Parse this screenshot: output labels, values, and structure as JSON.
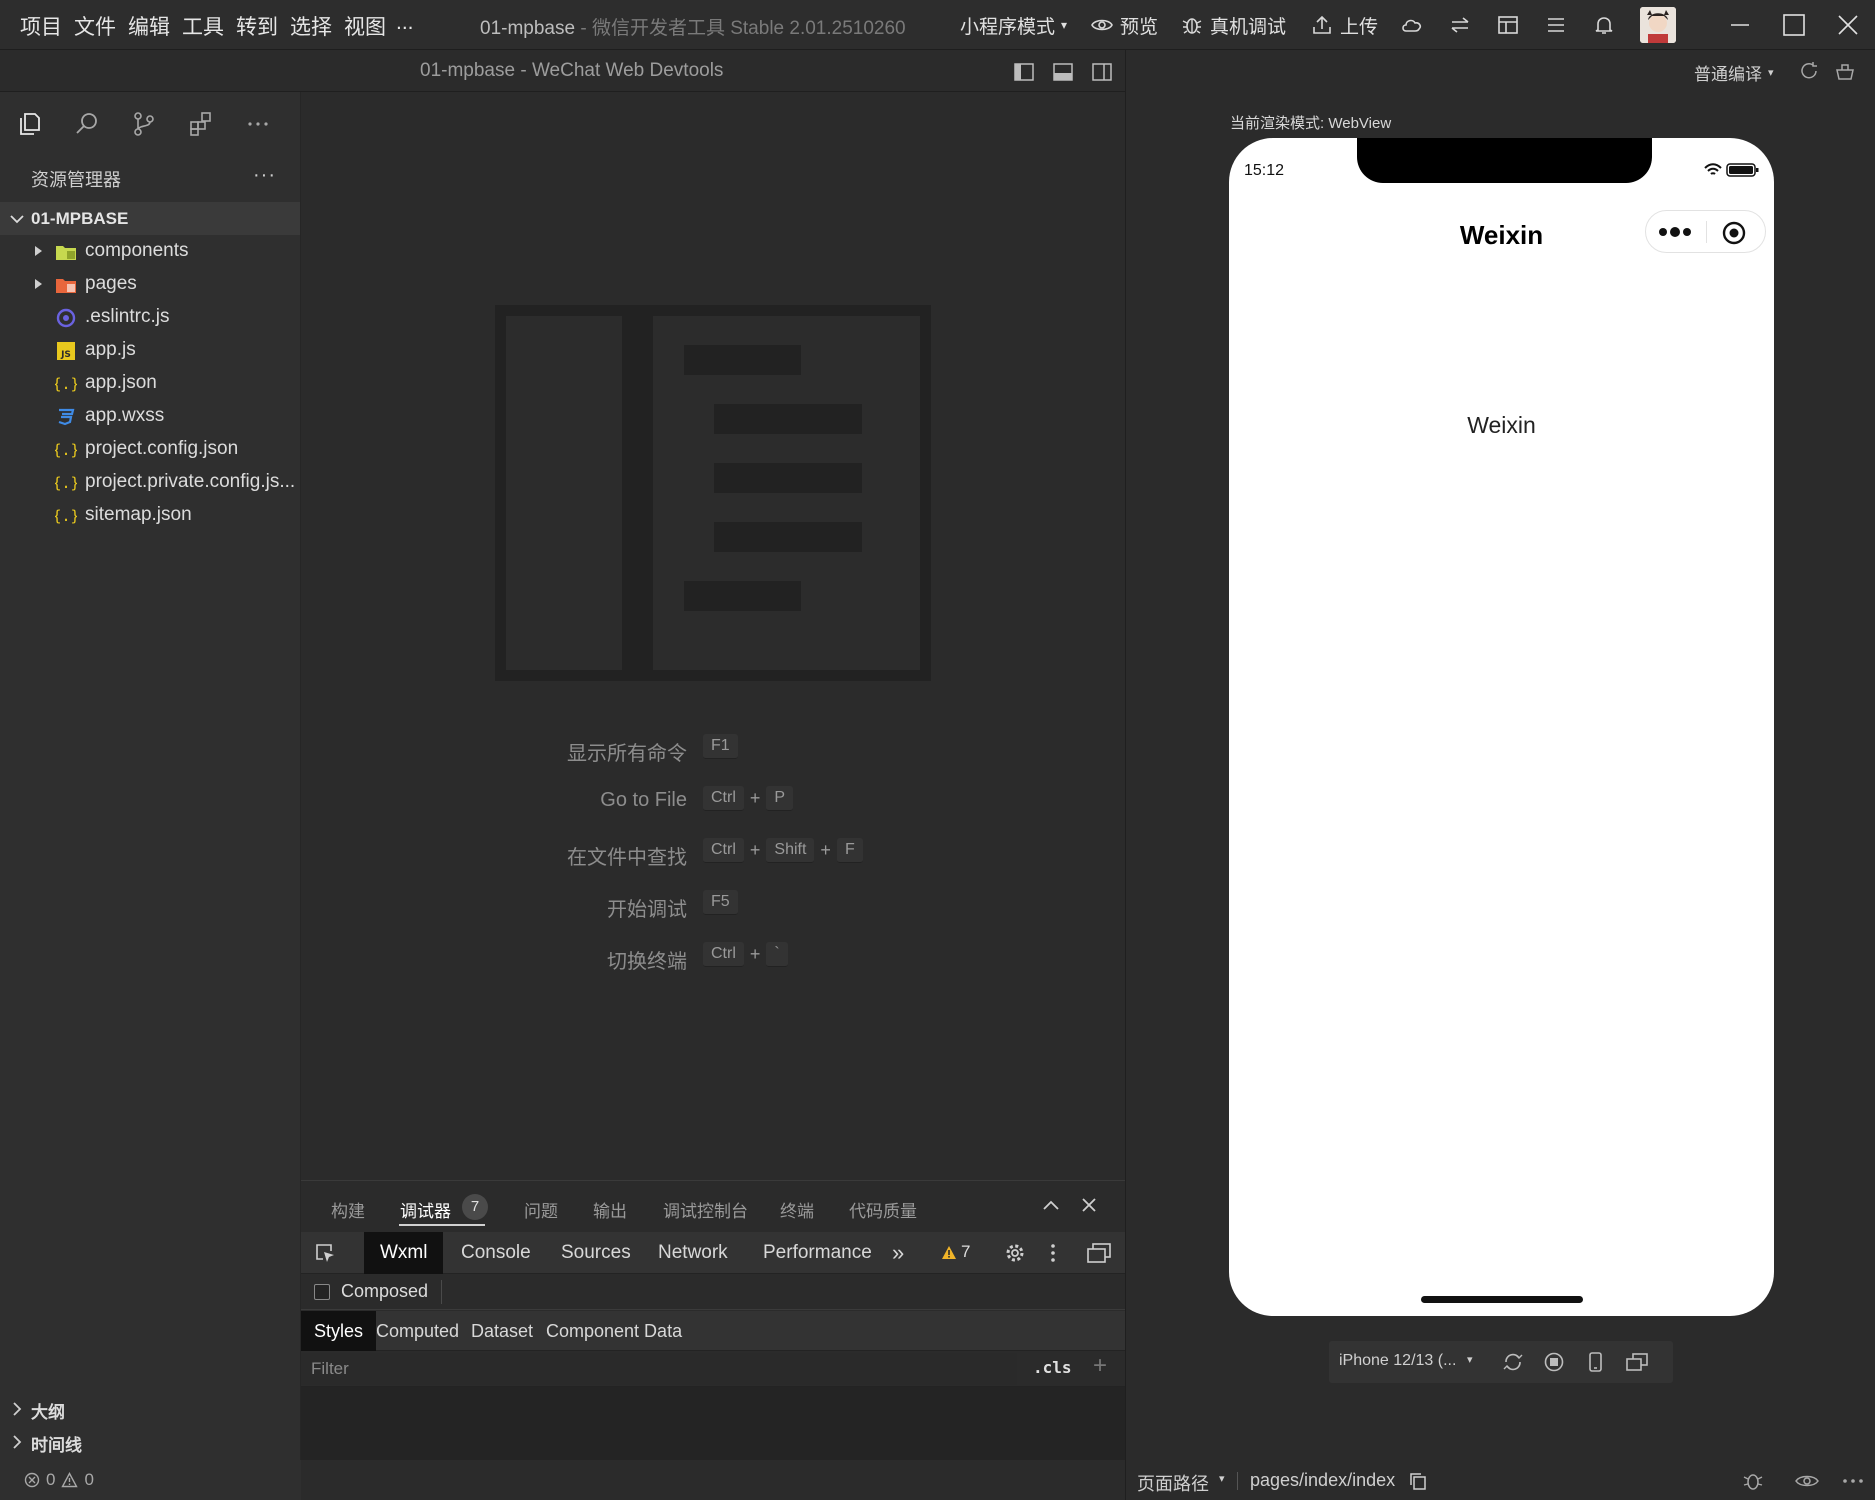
{
  "titlebar": {
    "menu": [
      "项目",
      "文件",
      "编辑",
      "工具",
      "转到",
      "选择",
      "视图",
      "..."
    ],
    "project": "01-mpbase",
    "subtitle": "- 微信开发者工具 Stable 2.01.2510260",
    "mode": "小程序模式",
    "preview": "预览",
    "device_debug": "真机调试",
    "upload": "上传",
    "icons": [
      "eye-icon",
      "bug-icon",
      "upload-icon",
      "cloud-icon",
      "swap-icon",
      "layout-icon",
      "menu-icon",
      "bell-icon"
    ]
  },
  "editor_header": {
    "title": "01-mpbase - WeChat Web Devtools",
    "compile_mode": "普通编译"
  },
  "sidebar": {
    "explorer_title": "资源管理器",
    "more": "···",
    "root": "01-MPBASE",
    "files": [
      {
        "name": "components",
        "type": "folder",
        "icon": "folder-components-icon",
        "color": "#c6d84f"
      },
      {
        "name": "pages",
        "type": "folder",
        "icon": "folder-pages-icon",
        "color": "#e8663c"
      },
      {
        "name": ".eslintrc.js",
        "type": "file",
        "icon": "eslint-icon",
        "color": "#6a62e0"
      },
      {
        "name": "app.js",
        "type": "file",
        "icon": "js-icon",
        "color": "#e8c81e"
      },
      {
        "name": "app.json",
        "type": "file",
        "icon": "json-icon",
        "color": "#e8c81e"
      },
      {
        "name": "app.wxss",
        "type": "file",
        "icon": "css-icon",
        "color": "#3f8be6"
      },
      {
        "name": "project.config.json",
        "type": "file",
        "icon": "json-icon",
        "color": "#e8c81e"
      },
      {
        "name": "project.private.config.js...",
        "type": "file",
        "icon": "json-icon",
        "color": "#e8c81e"
      },
      {
        "name": "sitemap.json",
        "type": "file",
        "icon": "json-icon",
        "color": "#e8c81e"
      }
    ],
    "outline": "大纲",
    "timeline": "时间线"
  },
  "welcome": {
    "commands": [
      {
        "label": "显示所有命令",
        "keys": [
          "F1"
        ]
      },
      {
        "label": "Go to File",
        "keys": [
          "Ctrl",
          "P"
        ]
      },
      {
        "label": "在文件中查找",
        "keys": [
          "Ctrl",
          "Shift",
          "F"
        ]
      },
      {
        "label": "开始调试",
        "keys": [
          "F5"
        ]
      },
      {
        "label": "切换终端",
        "keys": [
          "Ctrl",
          "`"
        ]
      }
    ]
  },
  "panel": {
    "tabs": [
      "构建",
      "调试器",
      "问题",
      "输出",
      "调试控制台",
      "终端",
      "代码质量"
    ],
    "active_tab": "调试器",
    "debugger_badge": "7",
    "devtools_tabs": [
      "Wxml",
      "Console",
      "Sources",
      "Network",
      "Performance"
    ],
    "devtools_more": "»",
    "warning_count": "7",
    "composed": "Composed",
    "style_tabs": [
      "Styles",
      "Computed",
      "Dataset",
      "Component Data"
    ],
    "filter_placeholder": "Filter",
    "cls": ".cls",
    "add": "+"
  },
  "status": {
    "errors": "0",
    "warnings": "0",
    "page_path_label": "页面路径",
    "page_path": "pages/index/index"
  },
  "simulator": {
    "render_mode": "当前渲染模式: WebView",
    "time": "15:12",
    "nav_title": "Weixin",
    "page_text": "Weixin",
    "device": "iPhone 12/13 (..."
  }
}
